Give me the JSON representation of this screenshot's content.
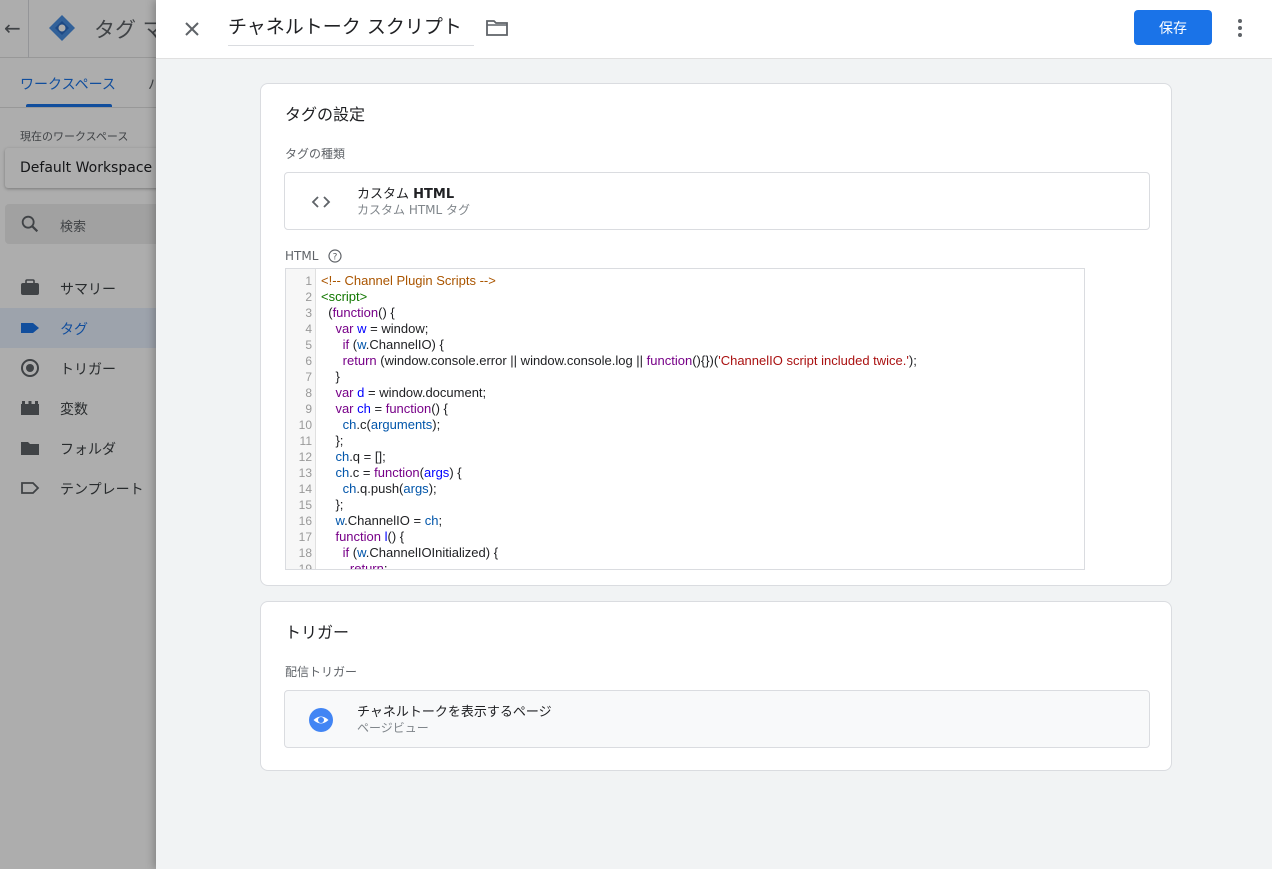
{
  "background": {
    "back_glyph": "←",
    "app_title": "タグ マ",
    "tabs": [
      {
        "label": "ワークスペース"
      },
      {
        "label": "バ"
      }
    ],
    "workspace_label": "現在のワークスペース",
    "workspace_name": "Default Workspace",
    "search_placeholder": "検索",
    "nav": [
      {
        "label": "サマリー",
        "icon": "briefcase-icon"
      },
      {
        "label": "タグ",
        "icon": "tag-icon"
      },
      {
        "label": "トリガー",
        "icon": "trigger-icon"
      },
      {
        "label": "変数",
        "icon": "variable-icon"
      },
      {
        "label": "フォルダ",
        "icon": "folder-icon"
      },
      {
        "label": "テンプレート",
        "icon": "template-icon"
      }
    ]
  },
  "header": {
    "title": "チャネルトーク スクリプト",
    "save_label": "保存"
  },
  "tag_config": {
    "title": "タグの設定",
    "type_label": "タグの種類",
    "type_name_prefix": "カスタム ",
    "type_name_bold": "HTML",
    "type_desc": "カスタム HTML タグ",
    "html_label": "HTML"
  },
  "code": {
    "lines": [
      [
        [
          "c-com",
          "<!-- Channel Plugin Scripts -->"
        ]
      ],
      [
        [
          "c-tag",
          "<script>"
        ]
      ],
      [
        [
          "",
          "  ("
        ],
        [
          "c-kw",
          "function"
        ],
        [
          "",
          "() {"
        ]
      ],
      [
        [
          "",
          "    "
        ],
        [
          "c-kw",
          "var"
        ],
        [
          "",
          " "
        ],
        [
          "c-def",
          "w"
        ],
        [
          "",
          " = window;"
        ]
      ],
      [
        [
          "",
          "      "
        ],
        [
          "c-kw",
          "if"
        ],
        [
          "",
          " ("
        ],
        [
          "c-var2",
          "w"
        ],
        [
          "",
          ".ChannelIO) {"
        ]
      ],
      [
        [
          "",
          "      "
        ],
        [
          "c-kw",
          "return"
        ],
        [
          "",
          " (window.console.error || window.console.log || "
        ],
        [
          "c-kw",
          "function"
        ],
        [
          "",
          "(){})("
        ],
        [
          "c-str",
          "'ChannelIO script included twice.'"
        ],
        [
          "",
          ");"
        ]
      ],
      [
        [
          "",
          "    }"
        ]
      ],
      [
        [
          "",
          "    "
        ],
        [
          "c-kw",
          "var"
        ],
        [
          "",
          " "
        ],
        [
          "c-def",
          "d"
        ],
        [
          "",
          " = window.document;"
        ]
      ],
      [
        [
          "",
          "    "
        ],
        [
          "c-kw",
          "var"
        ],
        [
          "",
          " "
        ],
        [
          "c-def",
          "ch"
        ],
        [
          "",
          " = "
        ],
        [
          "c-kw",
          "function"
        ],
        [
          "",
          "() {"
        ]
      ],
      [
        [
          "",
          "      "
        ],
        [
          "c-var2",
          "ch"
        ],
        [
          "",
          ".c("
        ],
        [
          "c-var2",
          "arguments"
        ],
        [
          "",
          ");"
        ]
      ],
      [
        [
          "",
          "    };"
        ]
      ],
      [
        [
          "",
          "    "
        ],
        [
          "c-var2",
          "ch"
        ],
        [
          "",
          ".q = [];"
        ]
      ],
      [
        [
          "",
          "    "
        ],
        [
          "c-var2",
          "ch"
        ],
        [
          "",
          ".c = "
        ],
        [
          "c-kw",
          "function"
        ],
        [
          "",
          "("
        ],
        [
          "c-def",
          "args"
        ],
        [
          "",
          ") {"
        ]
      ],
      [
        [
          "",
          "      "
        ],
        [
          "c-var2",
          "ch"
        ],
        [
          "",
          ".q.push("
        ],
        [
          "c-var2",
          "args"
        ],
        [
          "",
          ");"
        ]
      ],
      [
        [
          "",
          "    };"
        ]
      ],
      [
        [
          "",
          "    "
        ],
        [
          "c-var2",
          "w"
        ],
        [
          "",
          ".ChannelIO = "
        ],
        [
          "c-var2",
          "ch"
        ],
        [
          "",
          ";"
        ]
      ],
      [
        [
          "",
          "    "
        ],
        [
          "c-kw",
          "function"
        ],
        [
          "",
          " "
        ],
        [
          "c-def",
          "l"
        ],
        [
          "",
          "() {"
        ]
      ],
      [
        [
          "",
          "      "
        ],
        [
          "c-kw",
          "if"
        ],
        [
          "",
          " ("
        ],
        [
          "c-var2",
          "w"
        ],
        [
          "",
          ".ChannelIOInitialized) {"
        ]
      ],
      [
        [
          "",
          "        "
        ],
        [
          "c-kw",
          "return"
        ],
        [
          "",
          ";"
        ]
      ]
    ]
  },
  "trigger": {
    "title": "トリガー",
    "firing_label": "配信トリガー",
    "name": "チャネルトークを表示するページ",
    "type": "ページビュー"
  },
  "colors": {
    "accent": "#1a73e8",
    "trigger_icon": "#4285f4"
  }
}
